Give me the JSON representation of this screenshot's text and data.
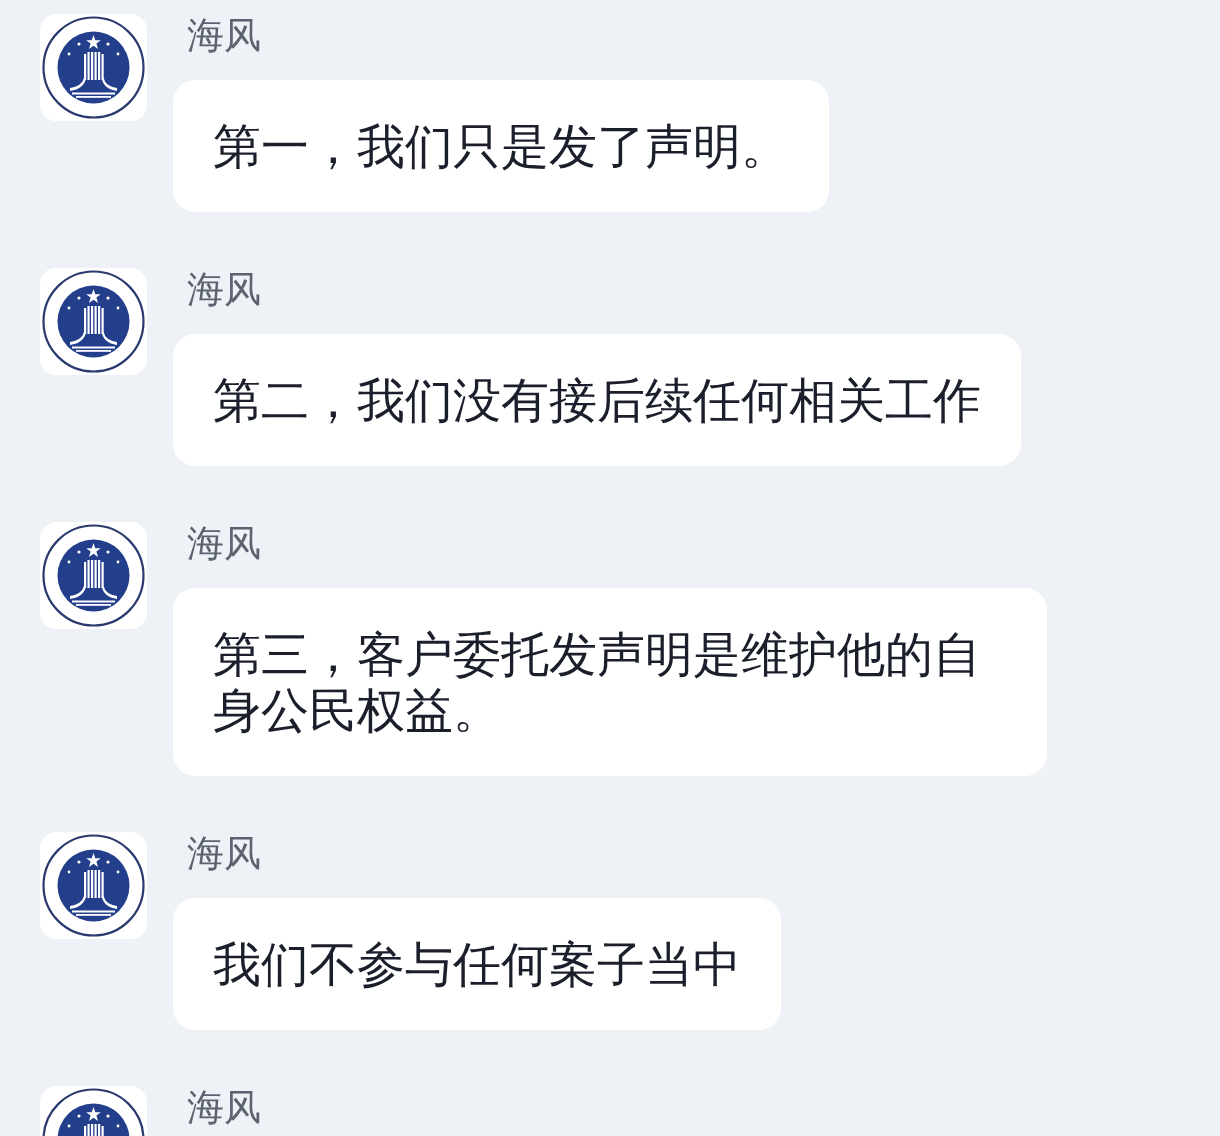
{
  "messages": [
    {
      "sender": "海风",
      "text": "第一，我们只是发了声明。"
    },
    {
      "sender": "海风",
      "text": "第二，我们没有接后续任何相关工作"
    },
    {
      "sender": "海风",
      "text": "第三，客户委托发声明是维护他的自身公民权益。"
    },
    {
      "sender": "海风",
      "text": "我们不参与任何案子当中"
    },
    {
      "sender": "海风"
    }
  ]
}
